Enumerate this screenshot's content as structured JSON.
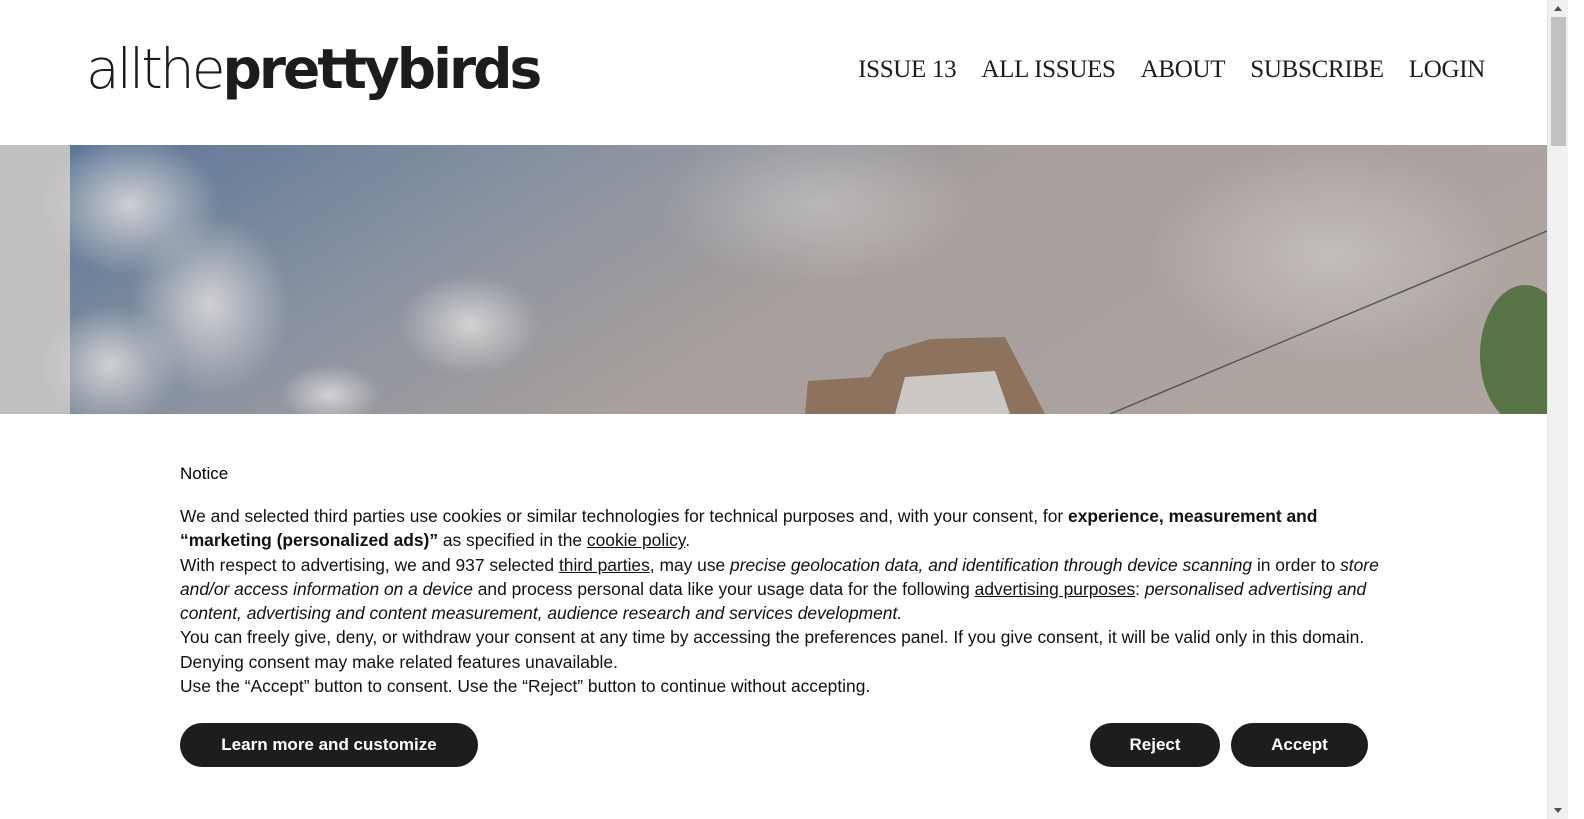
{
  "header": {
    "logo_light": "allthe",
    "logo_bold": "prettybirds",
    "nav": [
      "ISSUE 13",
      "ALL ISSUES",
      "ABOUT",
      "SUBSCRIBE",
      "LOGIN"
    ]
  },
  "notice": {
    "title": "Notice",
    "p1_a": "We and selected third parties use cookies or similar technologies for technical purposes and, with your consent, for ",
    "p1_bold": "experience, measurement and “marketing (personalized ads)”",
    "p1_b": " as specified in the ",
    "p1_link": "cookie policy",
    "p1_c": ".",
    "p2_a": "With respect to advertising, we and 937 selected ",
    "p2_link1": "third parties",
    "p2_b": ", may use ",
    "p2_i1": "precise geolocation data, and identification through device scanning",
    "p2_c": " in order to ",
    "p2_i2": "store and/or access information on a device",
    "p2_d": " and process personal data like your usage data for the following ",
    "p2_link2": "advertising purposes",
    "p2_e": ": ",
    "p2_i3": "personalised advertising and content, advertising and content measurement, audience research and services development",
    "p2_f": ".",
    "p3": "You can freely give, deny, or withdraw your consent at any time by accessing the preferences panel. If you give consent, it will be valid only in this domain. Denying consent may make related features unavailable.",
    "p4": "Use the “Accept” button to consent. Use the “Reject” button to continue without accepting.",
    "learn_label": "Learn more and customize",
    "reject_label": "Reject",
    "accept_label": "Accept"
  },
  "colors": {
    "button_bg": "#1d1d1d",
    "button_text": "#ffffff",
    "text": "#111111",
    "overlay": "#9a9a9a"
  }
}
